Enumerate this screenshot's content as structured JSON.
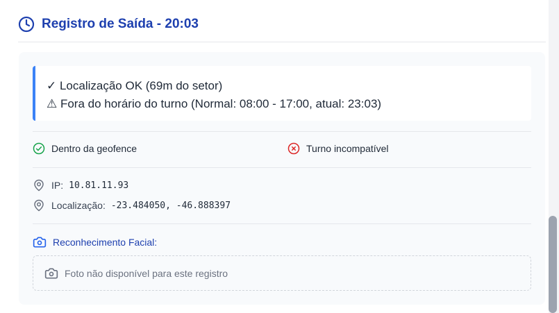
{
  "header": {
    "title": "Registro de Saída - 20:03",
    "icon": "clock-icon"
  },
  "alert": {
    "lines": [
      "✓ Localização OK (69m do setor)",
      "⚠ Fora do horário do turno (Normal: 08:00 - 17:00, atual: 23:03)"
    ]
  },
  "status": {
    "geofence": {
      "label": "Dentro da geofence",
      "icon": "check-circle-icon",
      "color": "#16a34a"
    },
    "shift": {
      "label": "Turno incompatível",
      "icon": "x-circle-icon",
      "color": "#dc2626"
    }
  },
  "info": {
    "ip_label": "IP:",
    "ip_value": "10.81.11.93",
    "location_label": "Localização:",
    "location_value": "-23.484050, -46.888397"
  },
  "facial": {
    "title": "Reconhecimento Facial:",
    "empty_text": "Foto não disponível para este registro"
  },
  "colors": {
    "accent": "#1e40af",
    "alert_border": "#3b82f6"
  }
}
